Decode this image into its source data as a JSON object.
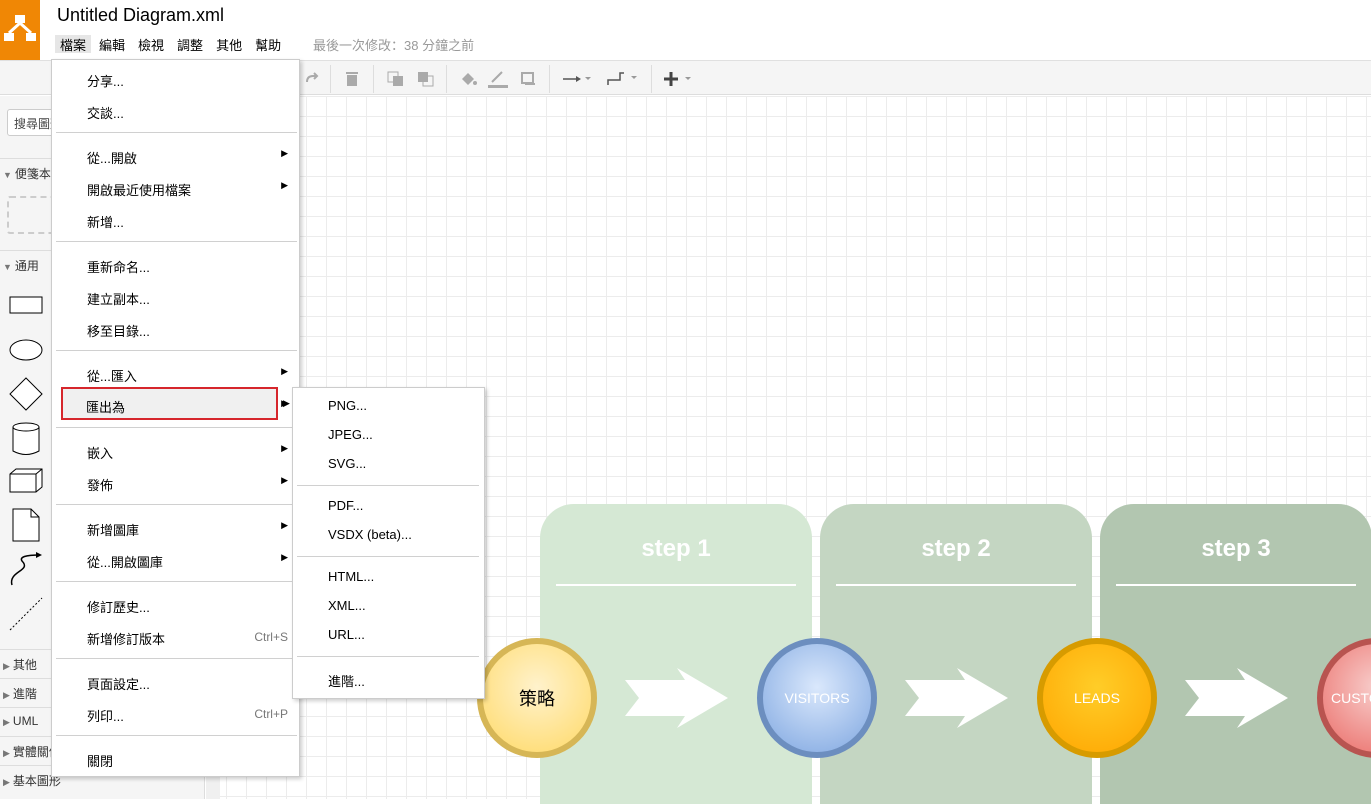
{
  "app": {
    "title": "Untitled Diagram.xml",
    "last_modified": "最後一次修改：38 分鐘之前"
  },
  "menubar": [
    "檔案",
    "編輯",
    "檢視",
    "調整",
    "其他",
    "幫助"
  ],
  "sidebar": {
    "search_placeholder": "搜尋圖形",
    "sections": {
      "scratchpad": "便箋本",
      "general": "通用",
      "misc": "其他",
      "advanced": "進階",
      "uml": "UML",
      "er": "實體關係",
      "basic": "基本圖形"
    }
  },
  "file_menu": {
    "share": "分享...",
    "chat": "交談...",
    "open_from": "從...開啟",
    "open_recent": "開啟最近使用檔案",
    "new": "新增...",
    "rename": "重新命名...",
    "make_copy": "建立副本...",
    "move_to_folder": "移至目錄...",
    "import_from": "從...匯入",
    "export_as": "匯出為",
    "embed": "嵌入",
    "publish": "發佈",
    "new_library": "新增圖庫",
    "open_library_from": "從...開啟圖庫",
    "revision_history": "修訂歷史...",
    "new_version": "新增修訂版本",
    "new_version_shortcut": "Ctrl+S",
    "page_setup": "頁面設定...",
    "print": "列印...",
    "print_shortcut": "Ctrl+P",
    "close": "關閉"
  },
  "export_submenu": {
    "png": "PNG...",
    "jpeg": "JPEG...",
    "svg": "SVG...",
    "pdf": "PDF...",
    "vsdx": "VSDX (beta)...",
    "html": "HTML...",
    "xml": "XML...",
    "url": "URL...",
    "advanced": "進階..."
  },
  "diagram": {
    "steps": [
      "step 1",
      "step 2",
      "step 3"
    ],
    "circles": [
      "策略",
      "VISITORS",
      "LEADS",
      "CUSTO"
    ]
  },
  "colors": {
    "brand": "#f08705",
    "highlight_border": "#d6262c",
    "step1": "#d5e8d4",
    "step2": "#c4d6c2",
    "step3": "#b2c6b0"
  }
}
